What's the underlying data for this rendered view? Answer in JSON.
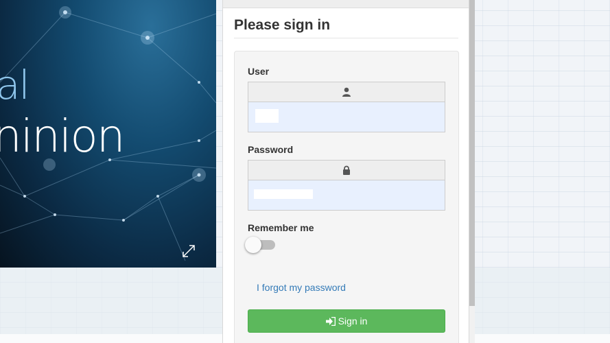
{
  "hero": {
    "text_line1": "al",
    "text_line2": "ninion",
    "expand_icon": "expand-icon"
  },
  "login": {
    "title": "Please sign in",
    "user_label": "User",
    "user_icon": "user-icon",
    "user_value": "",
    "password_label": "Password",
    "password_icon": "lock-icon",
    "password_value": "",
    "remember_label": "Remember me",
    "remember_on": false,
    "forgot_link": "I forgot my password",
    "signin_label": "Sign in",
    "signin_icon": "sign-in-icon"
  },
  "colors": {
    "primary_button": "#5cb85c",
    "link": "#337ab7",
    "autofill_bg": "#e8f0fe"
  }
}
